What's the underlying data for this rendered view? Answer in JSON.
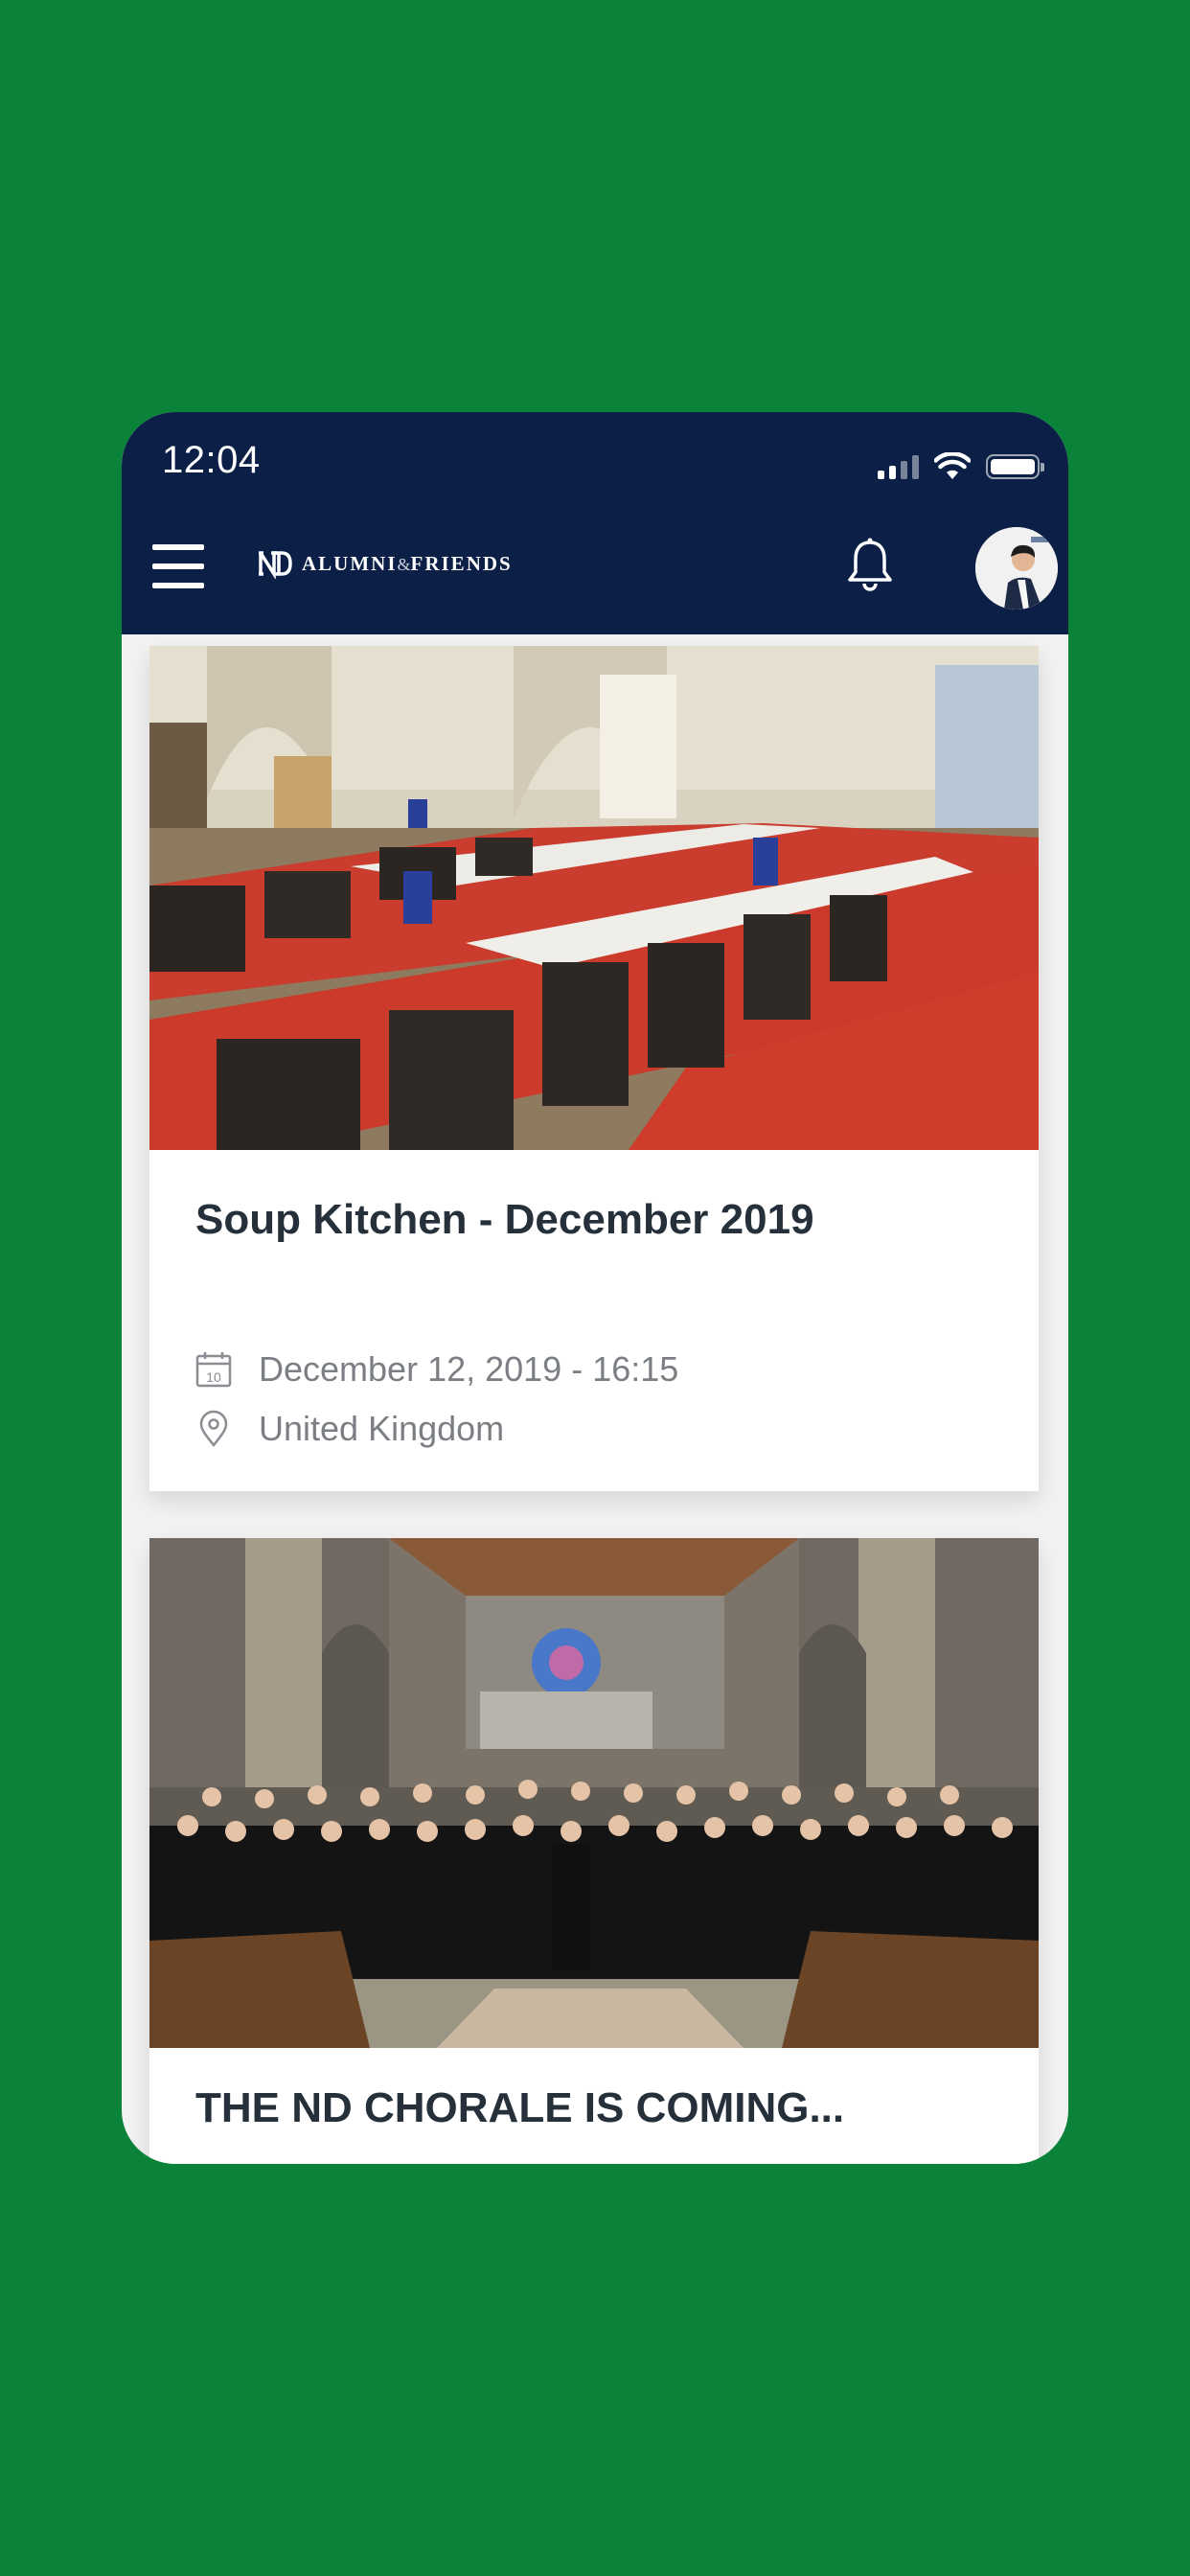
{
  "status_bar": {
    "time": "12:04",
    "signal_icon": "cellular-signal-icon",
    "wifi_icon": "wifi-icon",
    "battery_icon": "battery-icon"
  },
  "header": {
    "menu_icon": "hamburger-menu-icon",
    "logo_monogram": "ND",
    "brand_word_1": "ALUMNI",
    "brand_amp": "&",
    "brand_word_2": "FRIENDS",
    "notification_icon": "bell-icon",
    "avatar_icon": "user-avatar",
    "bar_color": "#0c2047"
  },
  "events": [
    {
      "title": "Soup Kitchen - December 2019",
      "date": "December 12, 2019 - 16:15",
      "date_icon_day": "10",
      "location": "United Kingdom",
      "image": "banquet-hall-red-tables"
    },
    {
      "title": "THE ND CHORALE IS COMING...",
      "image": "choir-in-cathedral"
    }
  ],
  "colors": {
    "background": "#0a8239",
    "card_title": "#26303b",
    "meta_text": "#7b7f84"
  }
}
